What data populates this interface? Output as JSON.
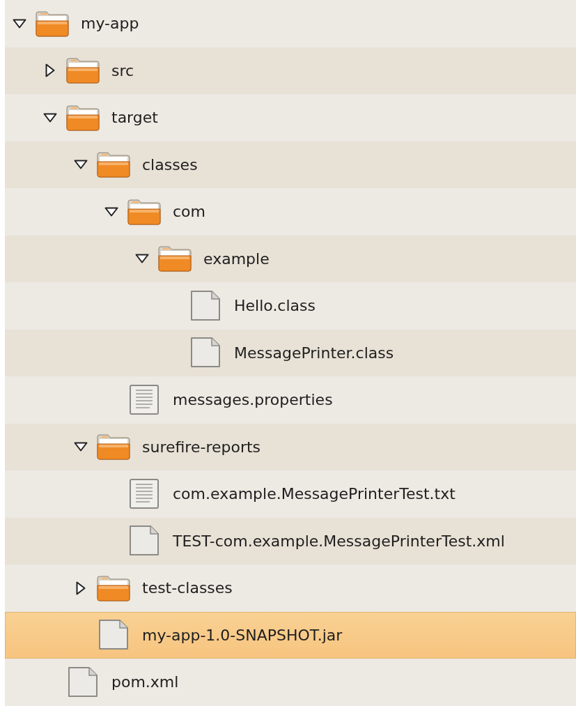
{
  "tree": [
    {
      "kind": "folder",
      "name": "my-app",
      "expanded": true,
      "selected": false,
      "children": [
        {
          "kind": "folder",
          "name": "src",
          "expanded": false,
          "selected": false
        },
        {
          "kind": "folder",
          "name": "target",
          "expanded": true,
          "selected": false,
          "children": [
            {
              "kind": "folder",
              "name": "classes",
              "expanded": true,
              "selected": false,
              "children": [
                {
                  "kind": "folder",
                  "name": "com",
                  "expanded": true,
                  "selected": false,
                  "children": [
                    {
                      "kind": "folder",
                      "name": "example",
                      "expanded": true,
                      "selected": false,
                      "children": [
                        {
                          "kind": "file",
                          "name": "Hello.class",
                          "selected": false
                        },
                        {
                          "kind": "file",
                          "name": "MessagePrinter.class",
                          "selected": false
                        }
                      ]
                    }
                  ]
                },
                {
                  "kind": "text",
                  "name": "messages.properties",
                  "selected": false
                }
              ]
            },
            {
              "kind": "folder",
              "name": "surefire-reports",
              "expanded": true,
              "selected": false,
              "children": [
                {
                  "kind": "text",
                  "name": "com.example.MessagePrinterTest.txt",
                  "selected": false
                },
                {
                  "kind": "file",
                  "name": "TEST-com.example.MessagePrinterTest.xml",
                  "selected": false
                }
              ]
            },
            {
              "kind": "folder",
              "name": "test-classes",
              "expanded": false,
              "selected": false
            },
            {
              "kind": "file",
              "name": "my-app-1.0-SNAPSHOT.jar",
              "selected": true
            }
          ]
        },
        {
          "kind": "file",
          "name": "pom.xml",
          "selected": false
        }
      ]
    }
  ]
}
